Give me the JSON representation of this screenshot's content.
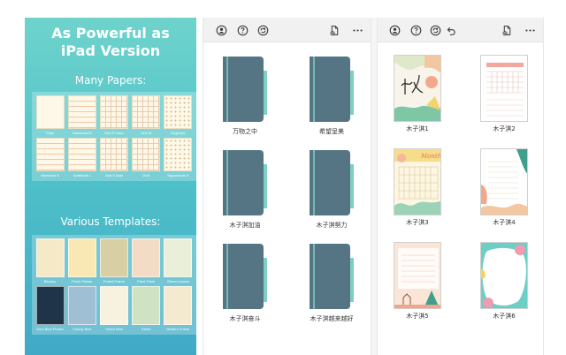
{
  "promo": {
    "title_line1": "As Powerful as",
    "title_line2": "iPad Version",
    "papers_heading": "Many Papers:",
    "templates_heading": "Various Templates:",
    "papers": [
      {
        "caption": "Plain",
        "style": "plain"
      },
      {
        "caption": "Notebook M",
        "style": "lined"
      },
      {
        "caption": "Grid S Color",
        "style": "grid"
      },
      {
        "caption": "Grid M",
        "style": "grid"
      },
      {
        "caption": "Engineer",
        "style": "dot"
      },
      {
        "caption": "Notebook S",
        "style": "lined"
      },
      {
        "caption": "Notebook L",
        "style": "lined"
      },
      {
        "caption": "Grid S Note",
        "style": "grid"
      },
      {
        "caption": "Grid",
        "style": "grid"
      },
      {
        "caption": "Squaredots S",
        "style": "dot"
      }
    ],
    "templates": [
      {
        "caption": "Bloomy",
        "color": "#f6e9c8"
      },
      {
        "caption": "Fresh Flower",
        "color": "#f9e8b3"
      },
      {
        "caption": "Forest Frame",
        "color": "#d8cfa4"
      },
      {
        "caption": "Plant Trunk",
        "color": "#f3dcc5"
      },
      {
        "caption": "Green Leaves",
        "color": "#e9efd8"
      },
      {
        "caption": "Dark Blue Flower",
        "color": "#1f3448"
      },
      {
        "caption": "Cloudy Blue",
        "color": "#9fbfd4"
      },
      {
        "caption": "Green Blue",
        "color": "#f7f1e0"
      },
      {
        "caption": "Green",
        "color": "#cfe3c4"
      },
      {
        "caption": "Modern Frame",
        "color": "#f4ead0"
      }
    ]
  },
  "left_panel": {
    "toolbar": {
      "icons": [
        "account-icon",
        "help-icon",
        "sync-icon",
        "new-note-icon",
        "more-icon"
      ]
    },
    "folders": [
      {
        "label": "万物之中"
      },
      {
        "label": "希望呈美"
      },
      {
        "label": "木子淇加油"
      },
      {
        "label": "木子淇努力"
      },
      {
        "label": "木子淇奋斗"
      },
      {
        "label": "木子淇越来越好"
      }
    ]
  },
  "right_panel": {
    "toolbar": {
      "icons": [
        "account-icon",
        "help-icon",
        "sync-icon",
        "back-icon",
        "new-note-icon",
        "more-icon"
      ]
    },
    "notes": [
      {
        "label": "木子淇1"
      },
      {
        "label": "木子淇2"
      },
      {
        "label": "木子淇3"
      },
      {
        "label": "木子淇4"
      },
      {
        "label": "木子淇5"
      },
      {
        "label": "木子淇6"
      }
    ],
    "month_banner": "Month"
  },
  "colors": {
    "folder_body": "#557585",
    "folder_tab": "#7fd0c3",
    "promo_top": "#6fd3cc",
    "promo_bottom": "#41a9c6"
  }
}
